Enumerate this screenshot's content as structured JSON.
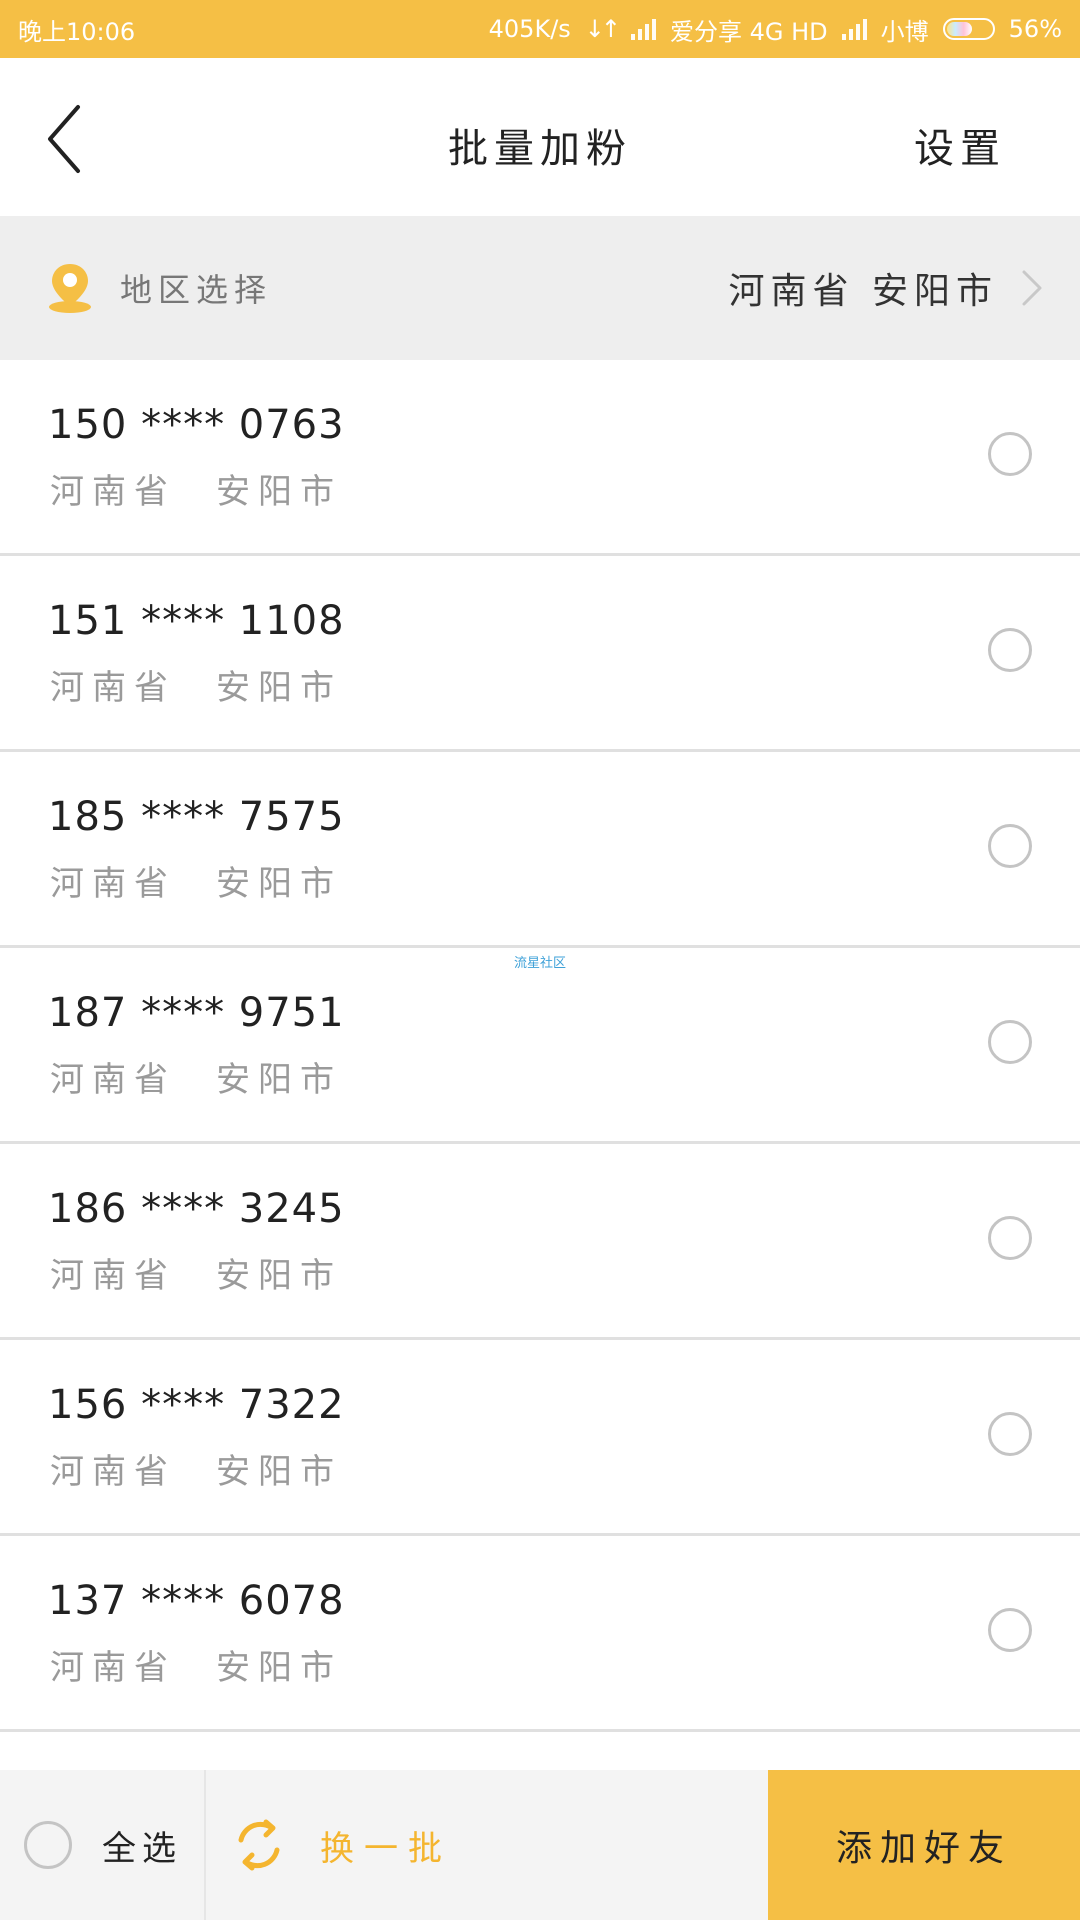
{
  "status_bar": {
    "time": "晚上10:06",
    "speed": "405K/s",
    "carrier": "爱分享 4G HD",
    "user": "小博",
    "battery": "56%",
    "battery_level": 0.56
  },
  "header": {
    "title": "批量加粉",
    "settings_label": "设置"
  },
  "region": {
    "label": "地区选择",
    "value": "河南省  安阳市",
    "accent_color": "#f5bf45"
  },
  "contacts": [
    {
      "phone": "150 **** 0763",
      "province": "河南省",
      "city": "安阳市"
    },
    {
      "phone": "151 **** 1108",
      "province": "河南省",
      "city": "安阳市"
    },
    {
      "phone": "185 **** 7575",
      "province": "河南省",
      "city": "安阳市"
    },
    {
      "phone": "187 **** 9751",
      "province": "河南省",
      "city": "安阳市"
    },
    {
      "phone": "186 **** 3245",
      "province": "河南省",
      "city": "安阳市"
    },
    {
      "phone": "156 **** 7322",
      "province": "河南省",
      "city": "安阳市"
    },
    {
      "phone": "137 **** 6078",
      "province": "河南省",
      "city": "安阳市"
    }
  ],
  "watermark": "流星社区",
  "bottom_bar": {
    "select_all_label": "全选",
    "refresh_label": "换一批",
    "add_button_label": "添加好友"
  },
  "colors": {
    "accent": "#f5bf45",
    "refresh_text": "#f4b52f",
    "divider": "#e0e0e0"
  }
}
